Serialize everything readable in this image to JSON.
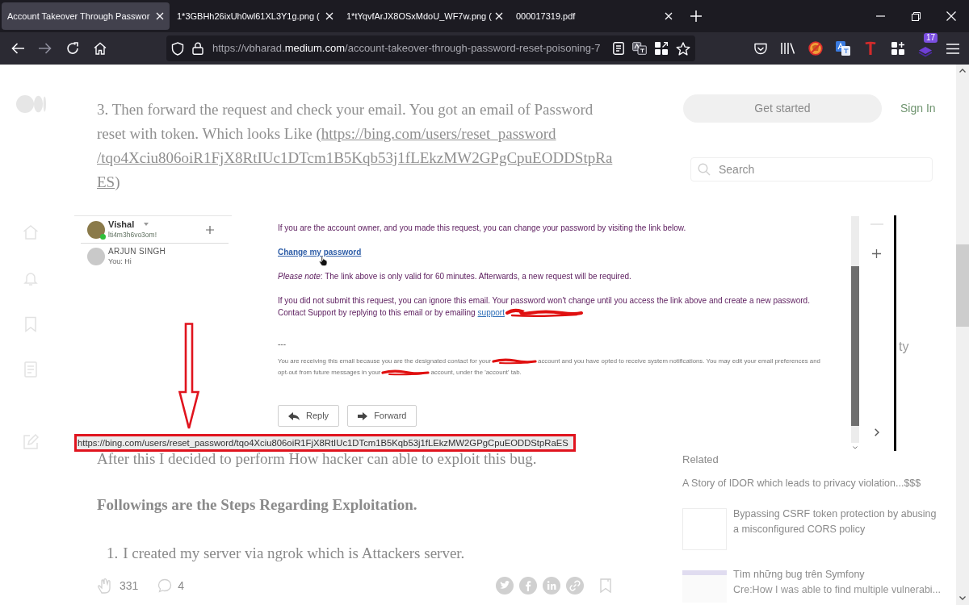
{
  "tabs": [
    {
      "title": "Account Takeover Through Passwor",
      "selected": true
    },
    {
      "title": "1*3GBHh26ixUh0wl61XL3Y1g.png (",
      "selected": false
    },
    {
      "title": "1*tYqvfArJX8OSxMdoU_WF7w.png (",
      "selected": false
    },
    {
      "title": "000017319.pdf",
      "selected": false
    }
  ],
  "address_bar": {
    "prefix": "https://vbharad.",
    "domain": "medium.com",
    "path": "/account-takeover-through-password-reset-poisoning-7"
  },
  "toolbar": {
    "badge": "17"
  },
  "header": {
    "get_started": "Get started",
    "sign_in": "Sign In",
    "search_placeholder": "Search"
  },
  "article_top_lines": [
    {
      "text": "3. Then forward the request and check your email. You got an email of Password"
    },
    {
      "text": "reset with token. Which looks Like (",
      "link": "https://bing.com/users/reset_password"
    },
    {
      "link": "/tqo4Xciu806oiR1FjX8RtIUc1DTcm1B5Kqb53j1fLEkzMW2GPgCpuEODDStpRa"
    },
    {
      "link": "ES",
      "text_after": ")"
    }
  ],
  "sidebar_cut_text": "ty",
  "screenshot": {
    "account": {
      "name": "Vishal",
      "status": "lti4m3h6vo3om!",
      "online": true
    },
    "chats": [
      {
        "name": "ARJUN SINGH",
        "preview": "You: Hi"
      }
    ],
    "email": {
      "intro": "If you are the account owner, and you made this request, you can change your password by visiting the link below.",
      "link": "Change my password",
      "note": "*Please note*: The link above is only valid for 60 minutes. Afterwards, a new request will be required.",
      "ignore": "If you did not submit this request, you can ignore this email. Your password won't change until you access the link above and create a new password.",
      "contact": {
        "text": "Contact Support by replying to this email or by emailing",
        "link": "support"
      },
      "separator": "---",
      "footer_lines": [
        {
          "before": "You are receiving this email because you are the designated contact for your",
          "after": "account and you have opted to receive system notifications. You may edit your email preferences and"
        },
        {
          "before": "opt-out from future messages in your",
          "after": "account, under the 'account' tab."
        }
      ],
      "buttons": [
        {
          "label": "Reply",
          "kind": "reply"
        },
        {
          "label": "Forward",
          "kind": "forward"
        }
      ]
    },
    "status_url": "https://bing.com/users/reset_password/tqo4Xciu806oiR1FjX8RtIUc1DTcm1B5Kqb53j1fLEkzMW2GPgCpuEODDStpRaES"
  },
  "article_bottom": [
    {
      "kind": "paragraph",
      "text": "After this I decided to perform How hacker can able to exploit this bug."
    },
    {
      "kind": "heading",
      "text": "Followings are the Steps Regarding Exploitation."
    },
    {
      "kind": "list_item",
      "number": "1.",
      "text": "I created my server via ngrok which is Attackers server."
    }
  ],
  "article_footer": {
    "claps": "331",
    "responses": "4"
  },
  "related": {
    "title": "Related",
    "items": [
      {
        "kind": "plain",
        "title": "A Story of IDOR which leads to privacy violation...$$$"
      },
      {
        "kind": "thumbnail",
        "title_lines": [
          "Bypassing CSRF token protection by abusing",
          "a misconfigured CORS policy"
        ]
      },
      {
        "kind": "thumbnail",
        "title_lines": [
          "Tìm những bug trên Symfony"
        ],
        "subtitle": "Cre:How I was able to find multiple vulnerabi..."
      }
    ]
  }
}
